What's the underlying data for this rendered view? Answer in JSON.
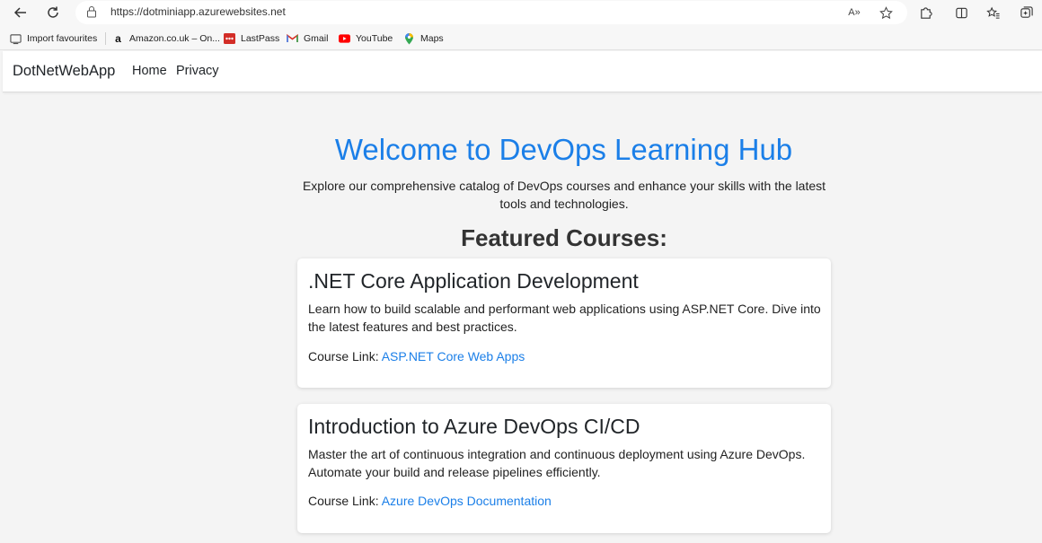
{
  "browser": {
    "url": "https://dotminiapp.azurewebsites.net",
    "read_aloud_icon": "A»",
    "favourites": [
      {
        "label": "Import favourites",
        "icon": "import-icon"
      },
      {
        "label": "Amazon.co.uk – On...",
        "icon": "amazon-icon"
      },
      {
        "label": "LastPass",
        "icon": "lastpass-icon"
      },
      {
        "label": "Gmail",
        "icon": "gmail-icon"
      },
      {
        "label": "YouTube",
        "icon": "youtube-icon"
      },
      {
        "label": "Maps",
        "icon": "maps-icon"
      }
    ]
  },
  "navbar": {
    "brand": "DotNetWebApp",
    "links": [
      "Home",
      "Privacy"
    ]
  },
  "hero": {
    "title": "Welcome to DevOps Learning Hub",
    "description": "Explore our comprehensive catalog of DevOps courses and enhance your skills with the latest tools and technologies."
  },
  "featured": {
    "heading": "Featured Courses:",
    "courses": [
      {
        "title": ".NET Core Application Development",
        "description": "Learn how to build scalable and performant web applications using ASP.NET Core. Dive into the latest features and best practices.",
        "link_prefix": "Course Link:",
        "link_text": "ASP.NET Core Web Apps"
      },
      {
        "title": "Introduction to Azure DevOps CI/CD",
        "description": "Master the art of continuous integration and continuous deployment using Azure DevOps. Automate your build and release pipelines efficiently.",
        "link_prefix": "Course Link:",
        "link_text": "Azure DevOps Documentation"
      }
    ]
  },
  "colors": {
    "accent": "#1b7fe8",
    "background": "#f4f4f4"
  }
}
